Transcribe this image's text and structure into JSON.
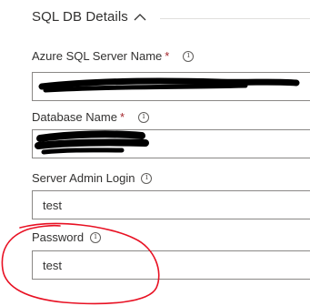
{
  "section": {
    "title": "SQL DB Details"
  },
  "fields": [
    {
      "label": "Azure SQL Server Name",
      "required": true,
      "value": ""
    },
    {
      "label": "Database Name",
      "required": true,
      "value": ""
    },
    {
      "label": "Server Admin Login",
      "required": false,
      "value": "test"
    },
    {
      "label": "Password",
      "required": false,
      "value": "test"
    }
  ],
  "required_marker": "*",
  "info_glyph": "i",
  "colors": {
    "required": "#a4262c",
    "annotation": "#e81123",
    "redaction": "#000000",
    "border": "#8a8886"
  },
  "icons": [
    "chevron-up-icon",
    "info-icon"
  ]
}
